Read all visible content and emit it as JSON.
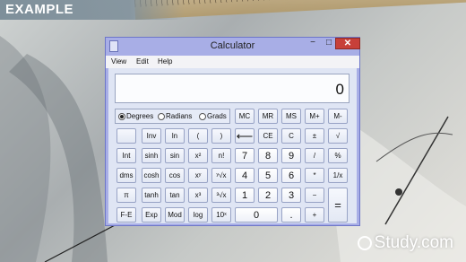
{
  "banner": {
    "label": "EXAMPLE"
  },
  "watermark": {
    "text": "Study.com"
  },
  "window": {
    "title": "Calculator",
    "controls": {
      "minimize": "−",
      "maximize": "□",
      "close": "✕"
    },
    "menu": [
      "View",
      "Edit",
      "Help"
    ]
  },
  "display": {
    "value": "0"
  },
  "angle_modes": {
    "options": [
      "Degrees",
      "Radians",
      "Grads"
    ],
    "selected": "Degrees"
  },
  "keys": {
    "mc": "MC",
    "mr": "MR",
    "ms": "MS",
    "mplus": "M+",
    "mminus": "M-",
    "blank": "",
    "inv": "Inv",
    "ln": "ln",
    "lparen": "(",
    "rparen": ")",
    "backspace": "⟵",
    "ce": "CE",
    "c": "C",
    "plusminus": "±",
    "sqrt": "√",
    "int": "Int",
    "sinh": "sinh",
    "sin": "sin",
    "xsq": "x²",
    "nfact": "n!",
    "n7": "7",
    "n8": "8",
    "n9": "9",
    "div": "/",
    "pct": "%",
    "dms": "dms",
    "cosh": "cosh",
    "cos": "cos",
    "xpowy": "xʸ",
    "yroot": "ʸ√x",
    "n4": "4",
    "n5": "5",
    "n6": "6",
    "mul": "*",
    "recip": "1/x",
    "pi": "π",
    "tanh": "tanh",
    "tan": "tan",
    "xcube": "x³",
    "cuberoot": "³√x",
    "n1": "1",
    "n2": "2",
    "n3": "3",
    "minus": "−",
    "equals": "=",
    "fe": "F-E",
    "exp": "Exp",
    "mod": "Mod",
    "log": "log",
    "tenx": "10ˣ",
    "n0": "0",
    "dot": ".",
    "plus": "+"
  }
}
